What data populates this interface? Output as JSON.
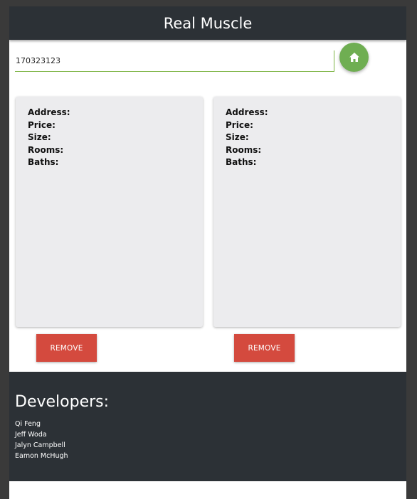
{
  "header": {
    "title": "Real Muscle"
  },
  "search": {
    "value": "170323123",
    "home_icon": "home-icon"
  },
  "cards": [
    {
      "fields": [
        {
          "label": "Address:",
          "value": ""
        },
        {
          "label": "Price:",
          "value": ""
        },
        {
          "label": "Size:",
          "value": ""
        },
        {
          "label": "Rooms:",
          "value": ""
        },
        {
          "label": "Baths:",
          "value": ""
        }
      ],
      "remove_label": "REMOVE"
    },
    {
      "fields": [
        {
          "label": "Address:",
          "value": ""
        },
        {
          "label": "Price:",
          "value": ""
        },
        {
          "label": "Size:",
          "value": ""
        },
        {
          "label": "Rooms:",
          "value": ""
        },
        {
          "label": "Baths:",
          "value": ""
        }
      ],
      "remove_label": "REMOVE"
    }
  ],
  "footer": {
    "title": "Developers:",
    "developers": [
      "Qi Feng",
      "Jeff Woda",
      "Jalyn Campbell",
      "Eamon McHugh"
    ]
  },
  "colors": {
    "header_bg": "#2c3136",
    "accent_green": "#6fae52",
    "remove_red": "#d44a3e",
    "card_bg": "#ececee"
  }
}
